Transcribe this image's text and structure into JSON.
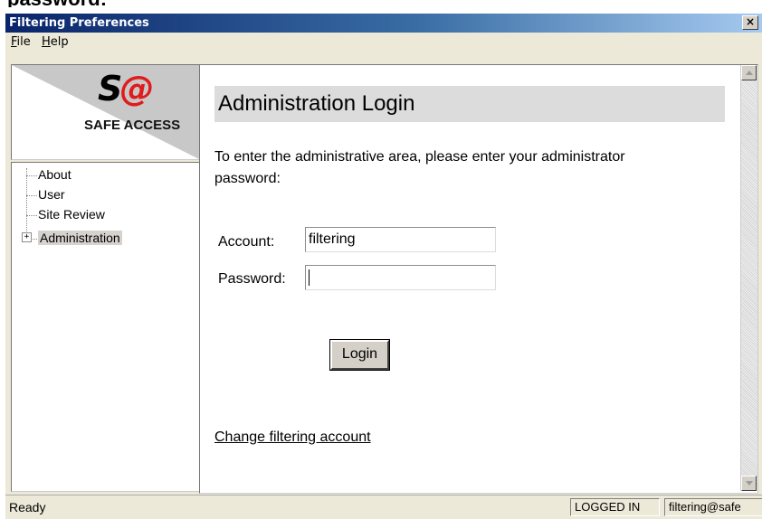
{
  "background_text": "password:",
  "window": {
    "title": "Filtering Preferences",
    "close_glyph": "×"
  },
  "menu": {
    "items": [
      {
        "label": "File",
        "accel": "F",
        "rest": "ile"
      },
      {
        "label": "Help",
        "accel": "H",
        "rest": "elp"
      }
    ]
  },
  "logo": {
    "mark_s": "S",
    "mark_at": "@",
    "text": "SAFE ACCESS",
    "accent_color": "#e11b1b"
  },
  "tree": {
    "items": [
      {
        "label": "About"
      },
      {
        "label": "User"
      },
      {
        "label": "Site Review"
      },
      {
        "label": "Administration",
        "expander": "+"
      }
    ]
  },
  "content": {
    "heading": "Administration Login",
    "intro_line1": "To enter the administrative area, please enter your administrator",
    "intro_line2": "password:",
    "account_label": "Account:",
    "account_value": "filtering",
    "password_label": "Password:",
    "password_value": "",
    "login_label": "Login",
    "change_link": "Change filtering account"
  },
  "statusbar": {
    "text": "Ready",
    "state": "LOGGED IN",
    "user": "filtering@safe"
  },
  "icons": {
    "scroll_up": "triangle-up-icon",
    "scroll_down": "triangle-down-icon",
    "close": "close-icon",
    "expander": "plus-box-icon"
  }
}
